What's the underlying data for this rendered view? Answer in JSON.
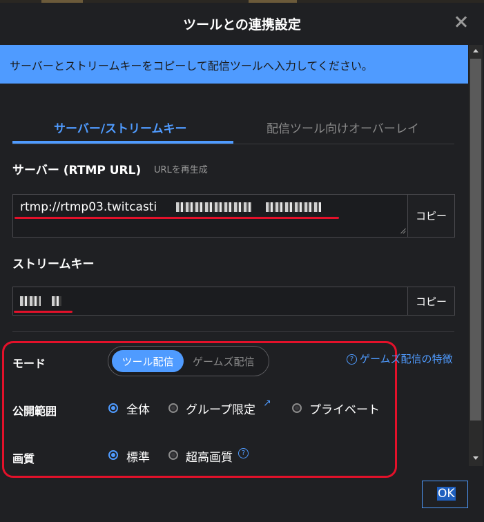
{
  "dialog": {
    "title": "ツールとの連携設定",
    "close_icon": "close-icon"
  },
  "banner": {
    "text": "サーバーとストリームキーをコピーして配信ツールへ入力してください。",
    "color": "#4f9bff"
  },
  "tabs": [
    {
      "label": "サーバー/ストリームキー",
      "active": true
    },
    {
      "label": "配信ツール向けオーバーレイ",
      "active": false
    }
  ],
  "server": {
    "label": "サーバー (RTMP URL)",
    "regenerate_link": "URLを再生成",
    "value": "rtmp://rtmp03.twitcasti",
    "copy_label": "コピー"
  },
  "stream_key": {
    "label": "ストリームキー",
    "copy_label": "コピー"
  },
  "mode": {
    "label": "モード",
    "options": [
      "ツール配信",
      "ゲームズ配信"
    ],
    "selected": "ツール配信",
    "help_link": "ゲームズ配信の特徴"
  },
  "visibility": {
    "label": "公開範囲",
    "options": [
      {
        "label": "全体",
        "selected": true
      },
      {
        "label": "グループ限定",
        "selected": false,
        "external_icon": "external-link-icon"
      },
      {
        "label": "プライベート",
        "selected": false
      }
    ]
  },
  "quality": {
    "label": "画質",
    "options": [
      {
        "label": "標準",
        "selected": true
      },
      {
        "label": "超高画質",
        "selected": false,
        "help_icon": "help-circle-icon"
      }
    ]
  },
  "footer": {
    "ok_label": "OK"
  },
  "colors": {
    "accent": "#4f9bff",
    "annotation_red": "#e3112a",
    "background": "#1f2023"
  }
}
